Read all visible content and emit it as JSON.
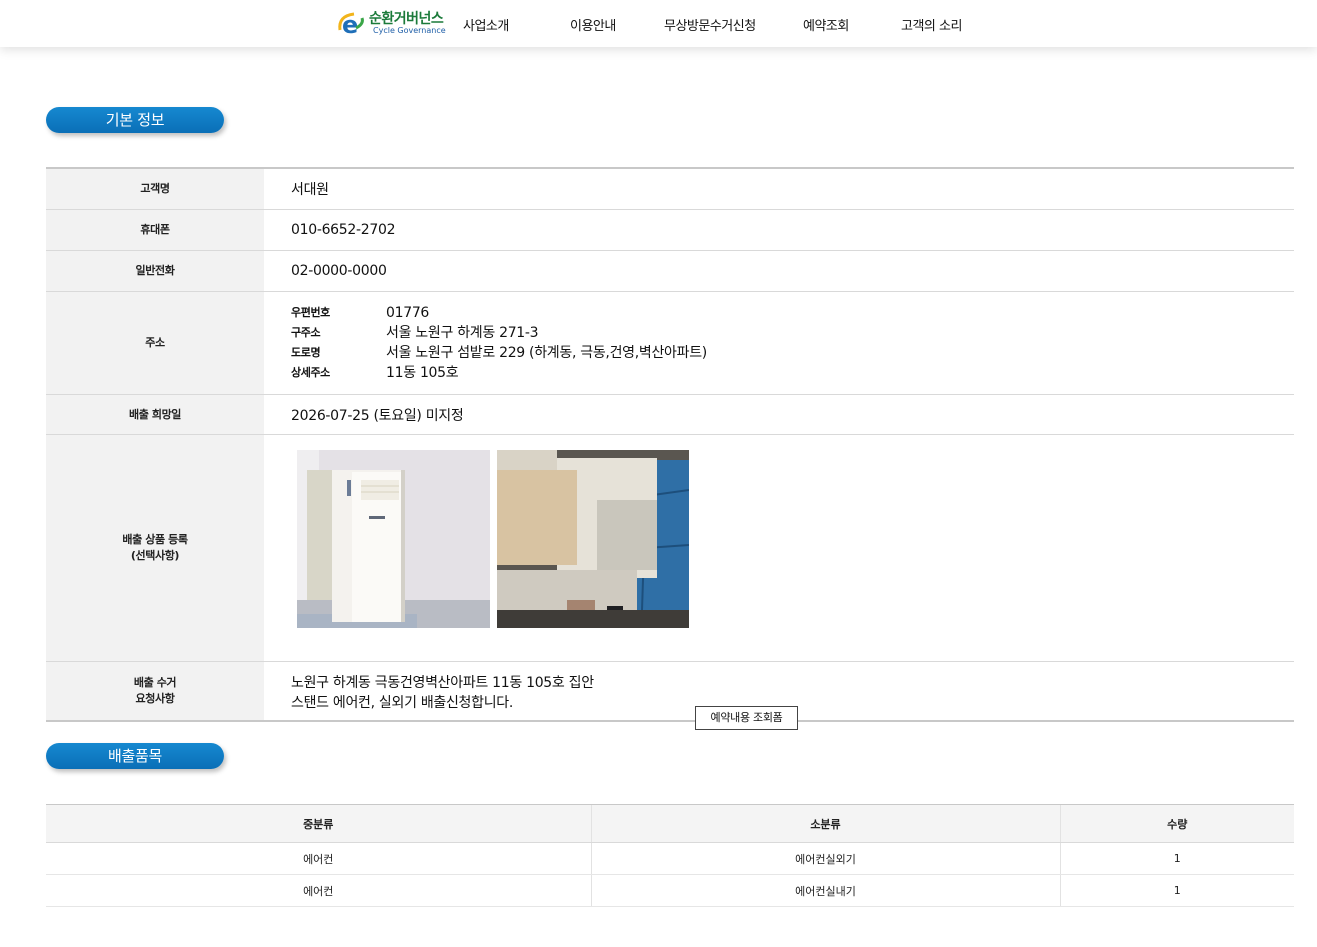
{
  "header": {
    "logo_ko": "순환거버넌스",
    "logo_en": "Cycle Governance",
    "nav": [
      "사업소개",
      "이용안내",
      "무상방문수거신청",
      "예약조회",
      "고객의 소리"
    ]
  },
  "basic_info": {
    "section_title": "기본 정보",
    "rows": {
      "customer_name": {
        "label": "고객명",
        "value": "서대원"
      },
      "mobile": {
        "label": "휴대폰",
        "value": "010-6652-2702"
      },
      "phone": {
        "label": "일반전화",
        "value": "02-0000-0000"
      },
      "address": {
        "label": "주소",
        "postal_label": "우편번호",
        "postal": "01776",
        "old_label": "구주소",
        "old": "서울 노원구 하계동 271-3",
        "road_label": "도로명",
        "road": "서울 노원구 섬밭로 229 (하계동, 극동,건영,벽산아파트)",
        "detail_label": "상세주소",
        "detail": "11동 105호"
      },
      "date": {
        "label": "배출 희망일",
        "value": "2026-07-25 (토요일) 미지정"
      },
      "products": {
        "label_line1": "배출 상품 등록",
        "label_line2": "(선택사항)"
      },
      "request": {
        "label_line1": "배출 수거",
        "label_line2": "요청사항",
        "line1": "노원구 하계동 극동건영벽산아파트 11동 105호 집안",
        "line2": "스탠드 에어컨, 실외기 배출신청합니다."
      }
    },
    "lookup_button": "예약내용 조회폼"
  },
  "items": {
    "section_title": "배출품목",
    "columns": [
      "중분류",
      "소분류",
      "수량"
    ],
    "rows": [
      [
        "에어컨",
        "에어컨실외기",
        "1"
      ],
      [
        "에어컨",
        "에어컨실내기",
        "1"
      ]
    ]
  },
  "colors": {
    "accent": "#0a7bc6",
    "header_bg": "#f2f2f2"
  }
}
